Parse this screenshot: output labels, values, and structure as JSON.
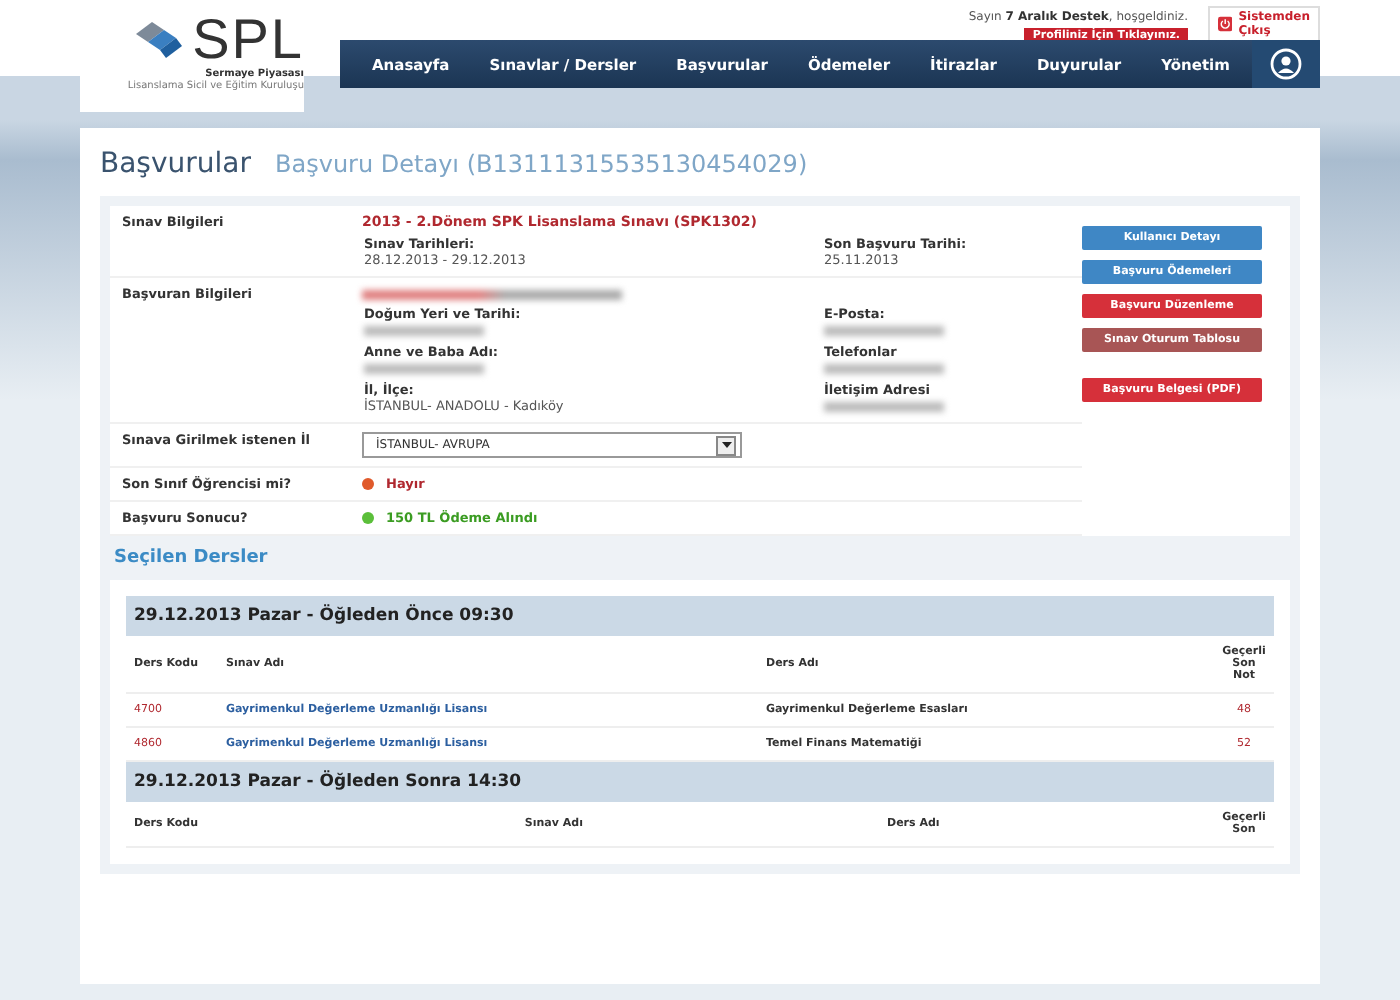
{
  "header": {
    "logo": {
      "text": "SPL",
      "subtitle_1": "Sermaye Piyasası",
      "subtitle_2": "Lisanslama Sicil ve Eğitim Kuruluşu"
    },
    "greeting": {
      "prefix": "Sayın",
      "name": "7 Aralık Destek",
      "suffix": ", hoşgeldiniz."
    },
    "profile_button": "Profiliniz İçin Tıklayınız.",
    "logout_button": "Sistemden Çıkış"
  },
  "nav": {
    "items": [
      "Anasayfa",
      "Sınavlar / Dersler",
      "Başvurular",
      "Ödemeler",
      "İtirazlar",
      "Duyurular",
      "Yönetim"
    ]
  },
  "page": {
    "title": "Başvurular",
    "subtitle": "Başvuru Detayı (B13111315535130454029)"
  },
  "info_rows": [
    {
      "kind": "exam",
      "label": "Sınav Bilgileri",
      "title": "2013 - 2.Dönem SPK Lisanslama Sınavı (SPK1302)",
      "fields": [
        {
          "label": "Sınav Tarihleri:",
          "value": "28.12.2013 - 29.12.2013"
        },
        {
          "label": "Son Başvuru Tarihi:",
          "value": "25.11.2013"
        }
      ]
    },
    {
      "kind": "applicant",
      "label": "Başvuran Bilgileri",
      "fields": [
        {
          "label": "Doğum Yeri ve Tarihi:"
        },
        {
          "label": "E-Posta:"
        },
        {
          "label": "Anne ve Baba Adı:"
        },
        {
          "label": "Telefonlar"
        },
        {
          "label": "İl, İlçe:",
          "value": "İSTANBUL- ANADOLU - Kadıköy"
        },
        {
          "label": "İletişim Adresi"
        }
      ]
    },
    {
      "kind": "select",
      "label": "Sınava Girilmek istenen İl",
      "value": "İSTANBUL- AVRUPA"
    },
    {
      "kind": "status",
      "label": "Son Sınıf Öğrencisi mi?",
      "ok": false,
      "value": "Hayır"
    },
    {
      "kind": "status",
      "label": "Başvuru Sonucu?",
      "ok": true,
      "value": "150 TL Ödeme Alındı"
    }
  ],
  "actions": [
    {
      "label": "Kullanıcı Detayı",
      "color": "#3f87c5"
    },
    {
      "label": "Başvuru Ödemeleri",
      "color": "#3f87c5"
    },
    {
      "label": "Başvuru Düzenleme",
      "color": "#d6303a"
    },
    {
      "label": "Sınav Oturum Tablosu",
      "color": "#a85555"
    },
    {
      "label": "Başvuru Belgesi (PDF)",
      "color": "#d6303a"
    }
  ],
  "selected_courses": {
    "title": "Seçilen Dersler",
    "sessions": [
      {
        "heading": "29.12.2013 Pazar - Öğleden Önce 09:30",
        "columns": [
          "Ders Kodu",
          "Sınav Adı",
          "Ders Adı",
          "Geçerli Son Not"
        ],
        "rows": [
          [
            "4700",
            "Gayrimenkul Değerleme Uzmanlığı Lisansı",
            "Gayrimenkul Değerleme Esasları",
            "48"
          ],
          [
            "4860",
            "Gayrimenkul Değerleme Uzmanlığı Lisansı",
            "Temel Finans Matematiği",
            "52"
          ]
        ]
      },
      {
        "heading": "29.12.2013 Pazar - Öğleden Sonra 14:30",
        "columns": [
          "Ders Kodu",
          "Sınav Adı",
          "Ders Adı",
          "Geçerli Son"
        ]
      }
    ]
  }
}
